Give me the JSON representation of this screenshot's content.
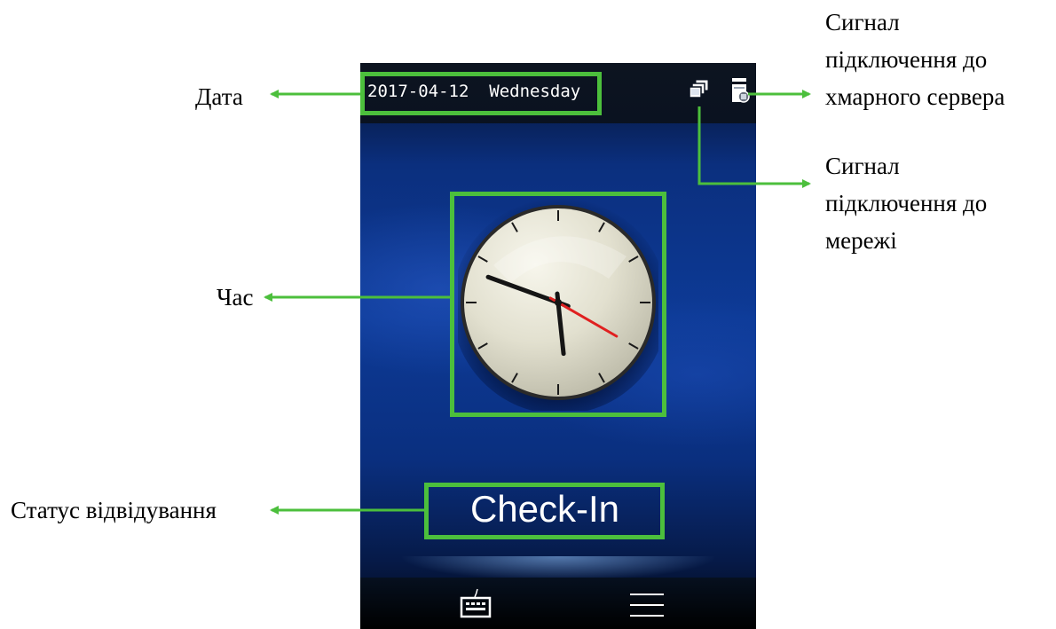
{
  "device": {
    "date": "2017-04-12",
    "weekday": "Wednesday",
    "network_icon": "network-connection-icon",
    "cloud_icon": "cloud-server-icon",
    "clock": {
      "hour": 5,
      "minute": 48,
      "second": 20
    },
    "attendance_status": "Check-In",
    "keyboard_icon": "keyboard-icon",
    "menu_icon": "menu-icon"
  },
  "callouts": {
    "date": "Дата",
    "time": "Час",
    "attendance_status": "Статус відвідування",
    "cloud_signal": [
      "Сигнал",
      "підключення до",
      "хмарного сервера"
    ],
    "network_signal": [
      "Сигнал",
      "підключення до",
      "мережі"
    ]
  },
  "colors": {
    "highlight": "#4cbf3c",
    "arrow": "#4cbf3c",
    "second_hand": "#e02020",
    "screen_blue": "#0d3a96"
  }
}
